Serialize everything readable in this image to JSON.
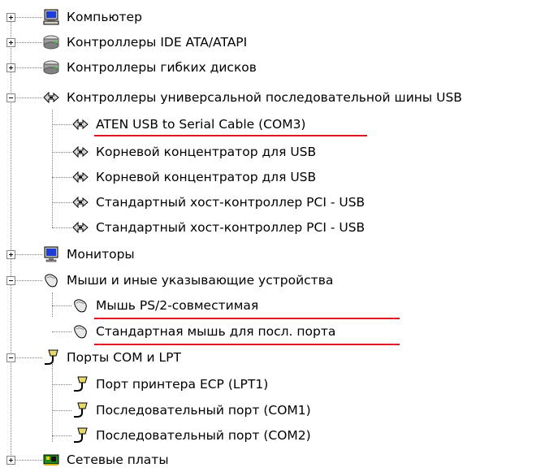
{
  "tree": {
    "computer": "Компьютер",
    "ide": "Контроллеры IDE ATA/ATAPI",
    "floppy": "Контроллеры гибких дисков",
    "usb": {
      "label": "Контроллеры универсальной последовательной шины USB",
      "children": [
        "ATEN USB to Serial Cable (COM3)",
        "Корневой концентратор для USB",
        "Корневой концентратор для USB",
        "Стандартный хост-контроллер PCI - USB",
        "Стандартный хост-контроллер PCI - USB"
      ]
    },
    "monitors": "Мониторы",
    "mice": {
      "label": "Мыши и иные указывающие устройства",
      "children": [
        "Мышь PS/2-совместимая",
        "Стандартная мышь для посл. порта"
      ]
    },
    "ports": {
      "label": "Порты COM и LPT",
      "children": [
        "Порт принтера ECP (LPT1)",
        "Последовательный порт (COM1)",
        "Последовательный порт (COM2)"
      ]
    },
    "network": "Сетевые платы"
  },
  "colors": {
    "highlight_underline": "#e0141e"
  }
}
